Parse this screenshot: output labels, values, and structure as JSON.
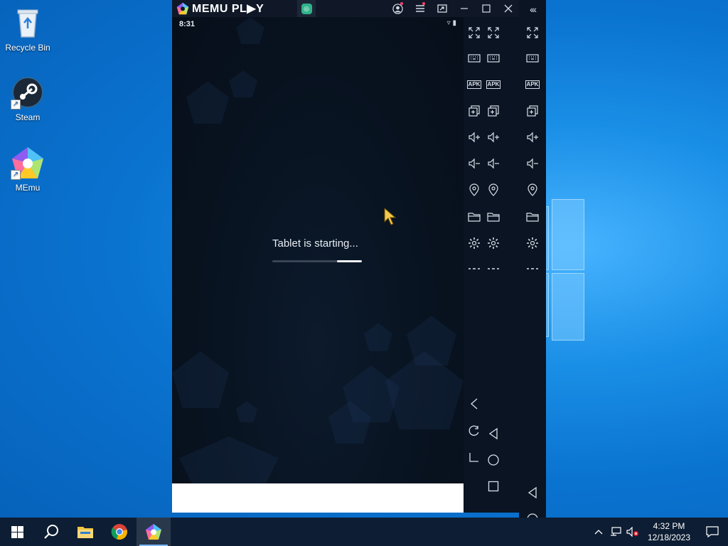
{
  "desktop": {
    "icons": [
      {
        "label": "Recycle Bin",
        "icon": "recycle-bin-icon"
      },
      {
        "label": "Steam",
        "icon": "steam-icon"
      },
      {
        "label": "MEmu",
        "icon": "memu-icon"
      }
    ]
  },
  "memu": {
    "app_name": "MEMU PL▶Y",
    "titlebar_buttons": [
      "account",
      "menu",
      "resize",
      "minimize",
      "maximize",
      "close",
      "collapse"
    ],
    "android": {
      "status_time": "8:31",
      "boot_message": "Tablet is starting...",
      "boot_progress": 0.28
    },
    "toolbar_tools": [
      "fullscreen",
      "keymapping",
      "apk-install",
      "multi-instance",
      "volume-up",
      "volume-down",
      "location",
      "shared-folder",
      "settings",
      "more"
    ],
    "apk_label": "APK",
    "nav_keys": [
      "back",
      "home",
      "recents"
    ],
    "overflow_glyph": "‹‹‹"
  },
  "taskbar": {
    "pinned": [
      "start",
      "search",
      "file-explorer",
      "chrome",
      "memu"
    ],
    "clock_time": "4:32 PM",
    "clock_date": "12/18/2023"
  },
  "colors": {
    "desktop_blue": "#0a73d0",
    "memu_dark": "#0a1422",
    "taskbar": "#0d1d33"
  }
}
